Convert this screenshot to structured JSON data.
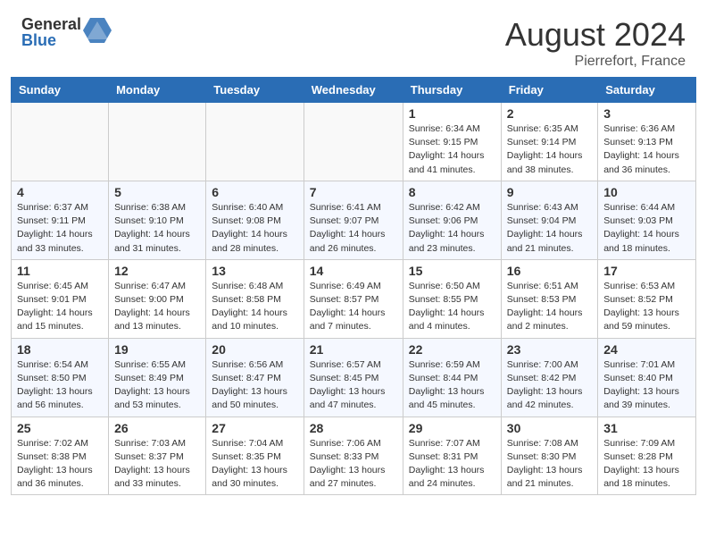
{
  "header": {
    "logo_general": "General",
    "logo_blue": "Blue",
    "month_title": "August 2024",
    "location": "Pierrefort, France"
  },
  "calendar": {
    "days_of_week": [
      "Sunday",
      "Monday",
      "Tuesday",
      "Wednesday",
      "Thursday",
      "Friday",
      "Saturday"
    ],
    "weeks": [
      [
        {
          "day": "",
          "info": ""
        },
        {
          "day": "",
          "info": ""
        },
        {
          "day": "",
          "info": ""
        },
        {
          "day": "",
          "info": ""
        },
        {
          "day": "1",
          "info": "Sunrise: 6:34 AM\nSunset: 9:15 PM\nDaylight: 14 hours\nand 41 minutes."
        },
        {
          "day": "2",
          "info": "Sunrise: 6:35 AM\nSunset: 9:14 PM\nDaylight: 14 hours\nand 38 minutes."
        },
        {
          "day": "3",
          "info": "Sunrise: 6:36 AM\nSunset: 9:13 PM\nDaylight: 14 hours\nand 36 minutes."
        }
      ],
      [
        {
          "day": "4",
          "info": "Sunrise: 6:37 AM\nSunset: 9:11 PM\nDaylight: 14 hours\nand 33 minutes."
        },
        {
          "day": "5",
          "info": "Sunrise: 6:38 AM\nSunset: 9:10 PM\nDaylight: 14 hours\nand 31 minutes."
        },
        {
          "day": "6",
          "info": "Sunrise: 6:40 AM\nSunset: 9:08 PM\nDaylight: 14 hours\nand 28 minutes."
        },
        {
          "day": "7",
          "info": "Sunrise: 6:41 AM\nSunset: 9:07 PM\nDaylight: 14 hours\nand 26 minutes."
        },
        {
          "day": "8",
          "info": "Sunrise: 6:42 AM\nSunset: 9:06 PM\nDaylight: 14 hours\nand 23 minutes."
        },
        {
          "day": "9",
          "info": "Sunrise: 6:43 AM\nSunset: 9:04 PM\nDaylight: 14 hours\nand 21 minutes."
        },
        {
          "day": "10",
          "info": "Sunrise: 6:44 AM\nSunset: 9:03 PM\nDaylight: 14 hours\nand 18 minutes."
        }
      ],
      [
        {
          "day": "11",
          "info": "Sunrise: 6:45 AM\nSunset: 9:01 PM\nDaylight: 14 hours\nand 15 minutes."
        },
        {
          "day": "12",
          "info": "Sunrise: 6:47 AM\nSunset: 9:00 PM\nDaylight: 14 hours\nand 13 minutes."
        },
        {
          "day": "13",
          "info": "Sunrise: 6:48 AM\nSunset: 8:58 PM\nDaylight: 14 hours\nand 10 minutes."
        },
        {
          "day": "14",
          "info": "Sunrise: 6:49 AM\nSunset: 8:57 PM\nDaylight: 14 hours\nand 7 minutes."
        },
        {
          "day": "15",
          "info": "Sunrise: 6:50 AM\nSunset: 8:55 PM\nDaylight: 14 hours\nand 4 minutes."
        },
        {
          "day": "16",
          "info": "Sunrise: 6:51 AM\nSunset: 8:53 PM\nDaylight: 14 hours\nand 2 minutes."
        },
        {
          "day": "17",
          "info": "Sunrise: 6:53 AM\nSunset: 8:52 PM\nDaylight: 13 hours\nand 59 minutes."
        }
      ],
      [
        {
          "day": "18",
          "info": "Sunrise: 6:54 AM\nSunset: 8:50 PM\nDaylight: 13 hours\nand 56 minutes."
        },
        {
          "day": "19",
          "info": "Sunrise: 6:55 AM\nSunset: 8:49 PM\nDaylight: 13 hours\nand 53 minutes."
        },
        {
          "day": "20",
          "info": "Sunrise: 6:56 AM\nSunset: 8:47 PM\nDaylight: 13 hours\nand 50 minutes."
        },
        {
          "day": "21",
          "info": "Sunrise: 6:57 AM\nSunset: 8:45 PM\nDaylight: 13 hours\nand 47 minutes."
        },
        {
          "day": "22",
          "info": "Sunrise: 6:59 AM\nSunset: 8:44 PM\nDaylight: 13 hours\nand 45 minutes."
        },
        {
          "day": "23",
          "info": "Sunrise: 7:00 AM\nSunset: 8:42 PM\nDaylight: 13 hours\nand 42 minutes."
        },
        {
          "day": "24",
          "info": "Sunrise: 7:01 AM\nSunset: 8:40 PM\nDaylight: 13 hours\nand 39 minutes."
        }
      ],
      [
        {
          "day": "25",
          "info": "Sunrise: 7:02 AM\nSunset: 8:38 PM\nDaylight: 13 hours\nand 36 minutes."
        },
        {
          "day": "26",
          "info": "Sunrise: 7:03 AM\nSunset: 8:37 PM\nDaylight: 13 hours\nand 33 minutes."
        },
        {
          "day": "27",
          "info": "Sunrise: 7:04 AM\nSunset: 8:35 PM\nDaylight: 13 hours\nand 30 minutes."
        },
        {
          "day": "28",
          "info": "Sunrise: 7:06 AM\nSunset: 8:33 PM\nDaylight: 13 hours\nand 27 minutes."
        },
        {
          "day": "29",
          "info": "Sunrise: 7:07 AM\nSunset: 8:31 PM\nDaylight: 13 hours\nand 24 minutes."
        },
        {
          "day": "30",
          "info": "Sunrise: 7:08 AM\nSunset: 8:30 PM\nDaylight: 13 hours\nand 21 minutes."
        },
        {
          "day": "31",
          "info": "Sunrise: 7:09 AM\nSunset: 8:28 PM\nDaylight: 13 hours\nand 18 minutes."
        }
      ]
    ]
  }
}
